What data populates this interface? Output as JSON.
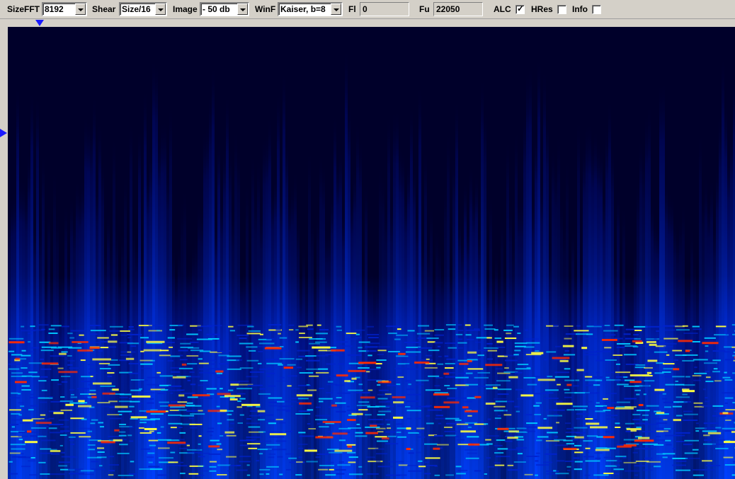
{
  "toolbar": {
    "sizefft": {
      "label": "SizeFFT",
      "value": "8192"
    },
    "shear": {
      "label": "Shear",
      "value": "Size/16"
    },
    "image": {
      "label": "Image",
      "value": "- 50 db"
    },
    "winf": {
      "label": "WinF",
      "value": "Kaiser, b=8"
    },
    "fl": {
      "label": "Fl",
      "value": "0"
    },
    "fu": {
      "label": "Fu",
      "value": "22050"
    },
    "alc": {
      "label": "ALC",
      "checked": true,
      "mark": "✓"
    },
    "hres": {
      "label": "HRes",
      "checked": false,
      "mark": ""
    },
    "info": {
      "label": "Info",
      "checked": false,
      "mark": ""
    }
  },
  "colors": {
    "background": "#00002a",
    "low": "#0022cc",
    "mid": "#00c8ff",
    "high": "#ffff40",
    "peak": "#ff2a00"
  }
}
